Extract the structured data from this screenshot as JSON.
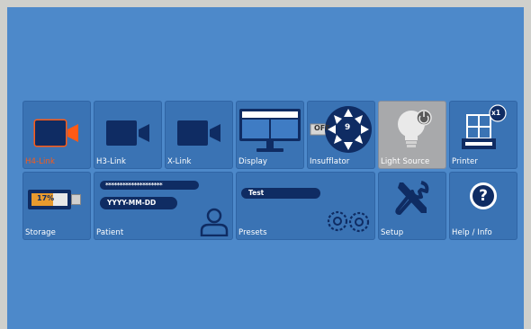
{
  "tiles": {
    "h4link": {
      "label": "H4-Link",
      "icon": "camera-icon"
    },
    "h3link": {
      "label": "H3-Link",
      "icon": "camera-icon"
    },
    "xlink": {
      "label": "X-Link",
      "icon": "camera-icon"
    },
    "display": {
      "label": "Display",
      "icon": "monitor-icon"
    },
    "insufflator": {
      "label": "Insufflator",
      "icon": "insufflator-icon",
      "status": "OFF",
      "value": "9"
    },
    "light_source": {
      "label": "Light Source",
      "icon": "lightbulb-icon"
    },
    "printer": {
      "label": "Printer",
      "icon": "printer-icon",
      "badge": "x1"
    },
    "storage": {
      "label": "Storage",
      "icon": "usb-storage-icon",
      "capacity": "17%"
    },
    "patient": {
      "label": "Patient",
      "icon": "patient-icon",
      "name_mask": "********************",
      "date": "YYYY-MM-DD"
    },
    "presets": {
      "label": "Presets",
      "icon": "gears-icon",
      "preset_name": "Test"
    },
    "setup": {
      "label": "Setup",
      "icon": "tools-icon"
    },
    "help": {
      "label": "Help / Info",
      "icon": "question-icon",
      "glyph": "?"
    }
  },
  "colors": {
    "background": "#4d89ca",
    "tile": "#3a73b4",
    "tile_active": "#a8a9ab",
    "icon_dark": "#0f2c63",
    "active_label": "#ff5a14"
  }
}
